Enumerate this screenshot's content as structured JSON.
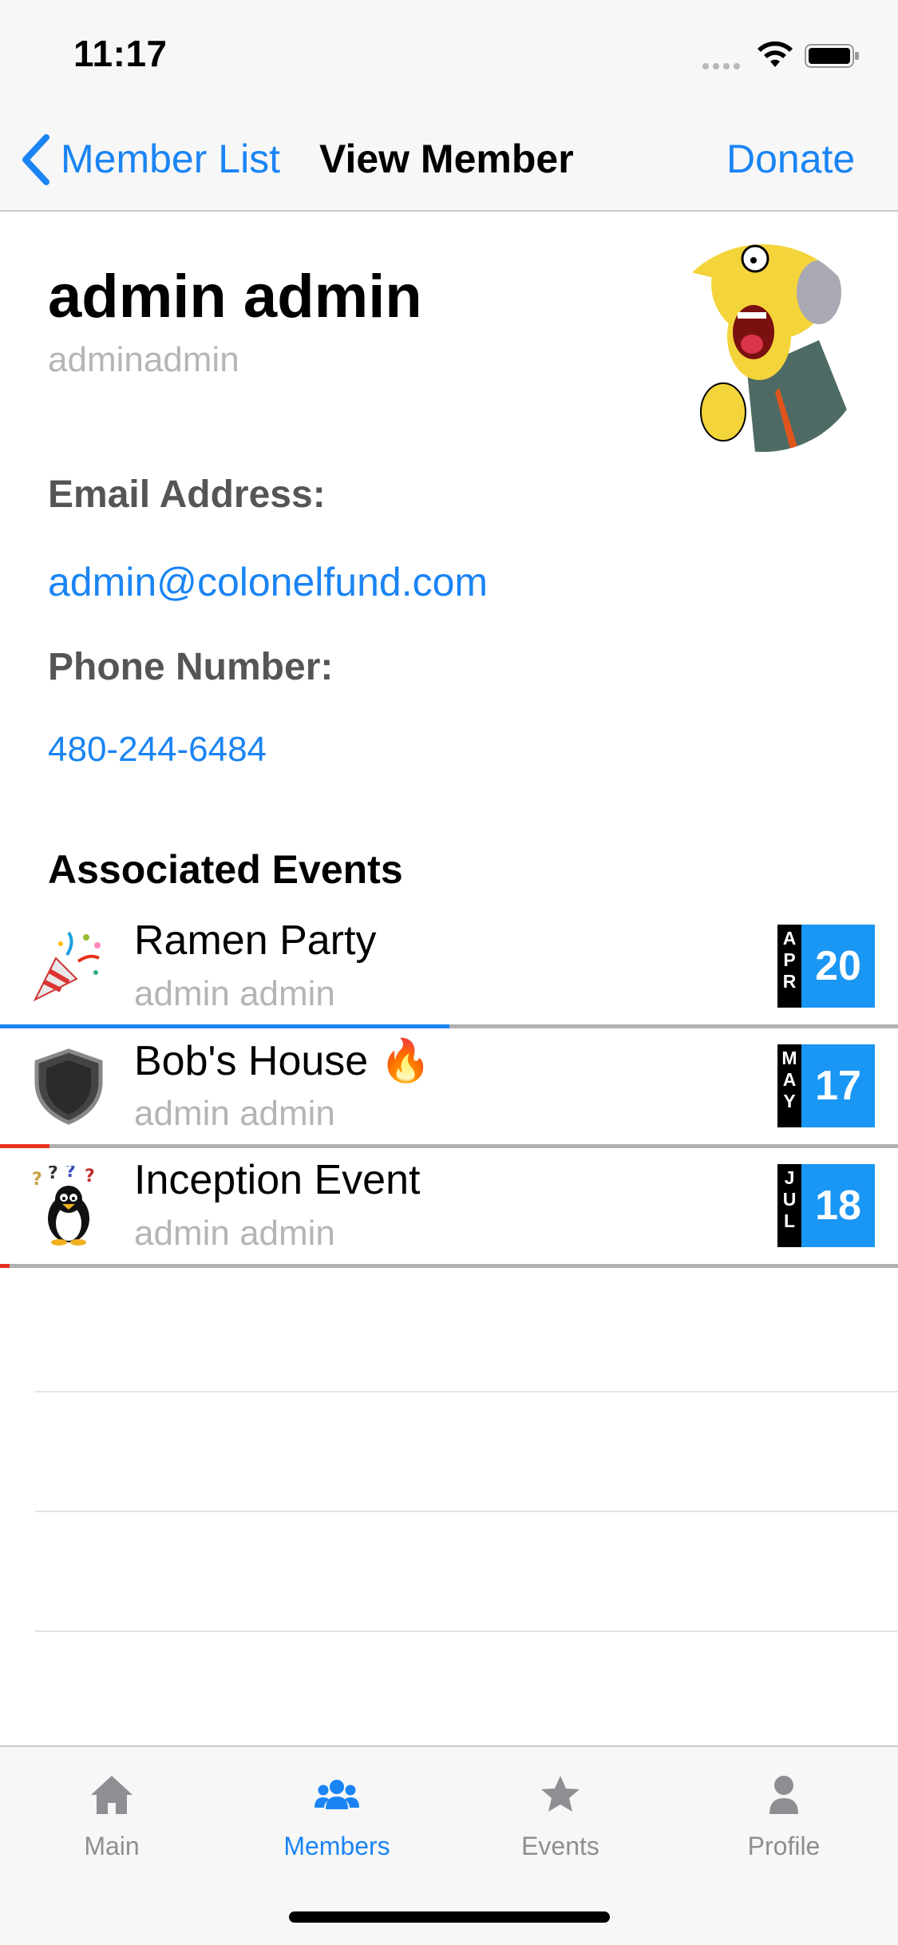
{
  "status_bar": {
    "time": "11:17"
  },
  "nav": {
    "back_label": "Member List",
    "title": "View Member",
    "action_label": "Donate"
  },
  "member": {
    "full_name": "admin admin",
    "username": "adminadmin",
    "email_heading": "Email Address:",
    "email": "admin@colonelfund.com",
    "phone_heading": "Phone Number:",
    "phone": "480-244-6484"
  },
  "events_heading": "Associated Events",
  "events": [
    {
      "title": "Ramen Party",
      "subtitle": "admin admin",
      "month": "APR",
      "day": "20",
      "icon": "party-popper-icon",
      "progress": 0.5,
      "progress_color": "#1a84f4"
    },
    {
      "title": "Bob's House 🔥",
      "subtitle": "admin admin",
      "month": "MAY",
      "day": "17",
      "icon": "shield-icon",
      "progress": 0.055,
      "progress_color": "#e8321e"
    },
    {
      "title": "Inception Event",
      "subtitle": "admin admin",
      "month": "JUL",
      "day": "18",
      "icon": "penguin-icon",
      "progress": 0.011,
      "progress_color": "#e8321e"
    }
  ],
  "tabs": [
    {
      "label": "Main",
      "icon": "home-icon",
      "active": false
    },
    {
      "label": "Members",
      "icon": "members-icon",
      "active": true
    },
    {
      "label": "Events",
      "icon": "star-icon",
      "active": false
    },
    {
      "label": "Profile",
      "icon": "profile-icon",
      "active": false
    }
  ],
  "colors": {
    "accent": "#1a84f4",
    "date_badge": "#1a96f4",
    "secondary_text": "#b5b5b5",
    "heading_gray": "#555555",
    "alert": "#e8321e"
  }
}
